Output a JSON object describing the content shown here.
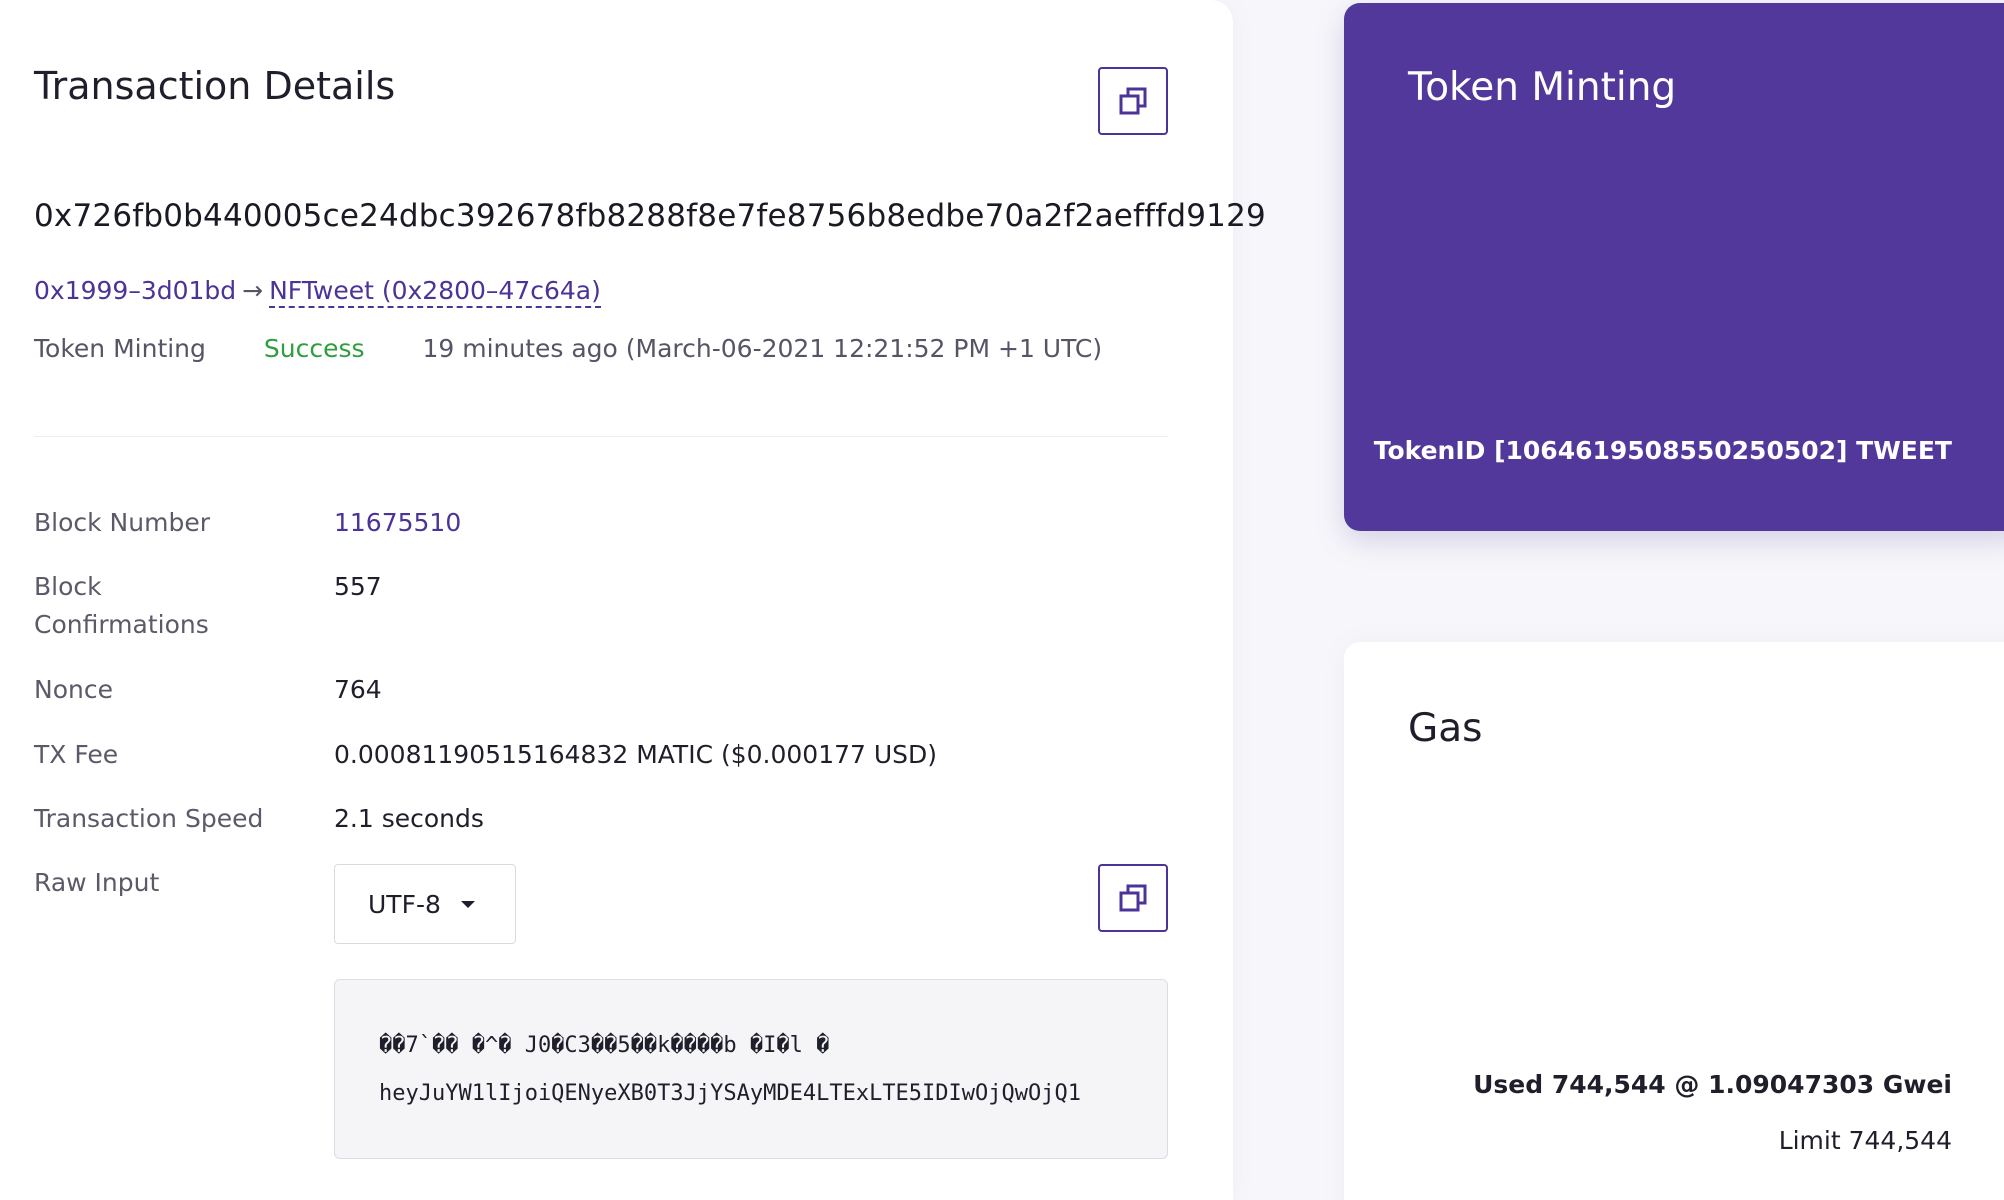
{
  "transaction": {
    "title": "Transaction Details",
    "hash": "0x726fb0b440005ce24dbc392678fb8288f8e7fe8756b8edbe70a2f2aefffd9129",
    "from": "0x1999–3d01bd",
    "arrow": "→",
    "to": "NFTweet (0x2800–47c64a)",
    "method": "Token Minting",
    "status": "Success",
    "time": "19 minutes ago (March-06-2021 12:21:52 PM +1 UTC)"
  },
  "details": {
    "block_number": {
      "label": "Block Number",
      "value": "11675510"
    },
    "block_confirmations": {
      "label": "Block Confirmations",
      "value": "557"
    },
    "nonce": {
      "label": "Nonce",
      "value": "764"
    },
    "tx_fee": {
      "label": "TX Fee",
      "value": "0.00081190515164832 MATIC ($0.000177 USD)"
    },
    "transaction_speed": {
      "label": "Transaction Speed",
      "value": "2.1 seconds"
    },
    "raw_input": {
      "label": "Raw Input",
      "encoding": "UTF-8",
      "line1": "��7`�� �^� J0�C3��5��k����b �I�l �",
      "line2": "heyJuYW1lIjoiQENyeXB0T3JjYSAyMDE4LTExLTE5IDIwOjQwOjQ1"
    }
  },
  "token_card": {
    "title": "Token Minting",
    "token_id": "TokenID [1064619508550250502] TWEET"
  },
  "gas_card": {
    "title": "Gas",
    "used": "Used 744,544 @ 1.09047303 Gwei",
    "limit": "Limit 744,544"
  },
  "colors": {
    "accent": "#4c3397",
    "card_purple": "#53389b",
    "success": "#2e9e3e"
  },
  "icons": {
    "copy": "copy-icon",
    "dropdown": "chevron-down-icon"
  }
}
